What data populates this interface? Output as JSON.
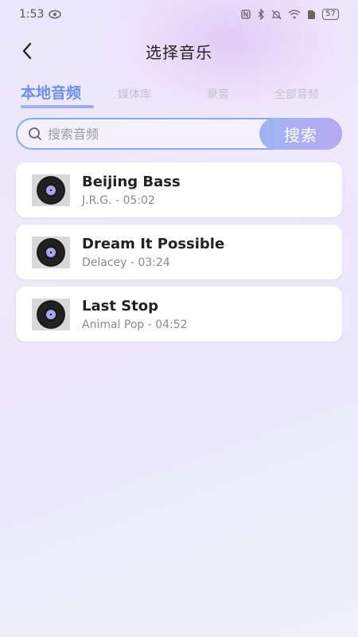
{
  "status": {
    "time": "1:53",
    "battery": "57"
  },
  "header": {
    "title": "选择音乐"
  },
  "tabs": [
    {
      "label": "本地音频",
      "active": true
    },
    {
      "label": "媒体库",
      "active": false
    },
    {
      "label": "录音",
      "active": false
    },
    {
      "label": "全部音频",
      "active": false
    }
  ],
  "search": {
    "placeholder": "搜索音频",
    "value": "",
    "button_label": "搜索"
  },
  "songs": [
    {
      "title": "Beijing Bass",
      "subtitle": "J.R.G. - 05:02"
    },
    {
      "title": "Dream It Possible",
      "subtitle": "Delacey - 03:24"
    },
    {
      "title": "Last Stop",
      "subtitle": "Animal Pop - 04:52"
    }
  ],
  "colors": {
    "accent": "#6f90e6",
    "tab_inactive": "#c4c2d0",
    "search_border": "#8aa7ef"
  },
  "icons": {
    "back": "chevron-left-icon",
    "search": "search-icon",
    "cover": "vinyl-record-icon"
  }
}
